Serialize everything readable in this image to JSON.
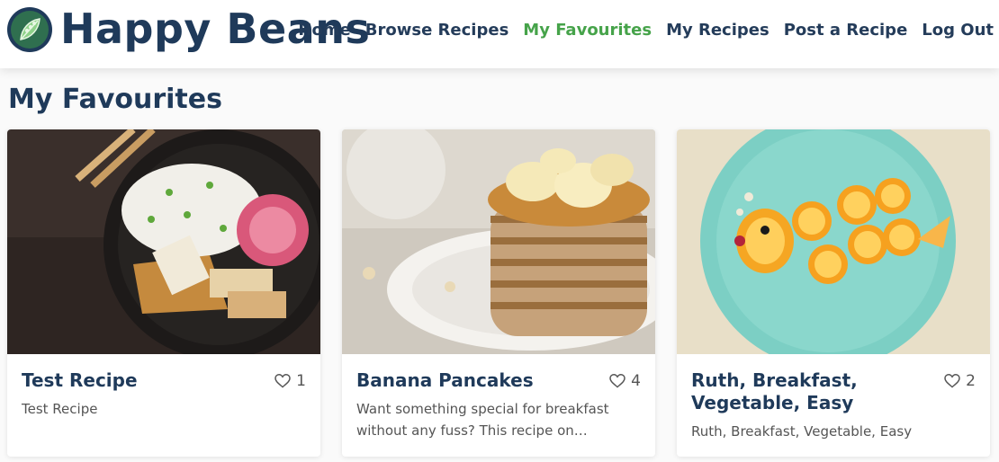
{
  "brand": {
    "name": "Happy Beans",
    "logo_icon": "leaf-icon"
  },
  "nav": {
    "items": [
      {
        "label": "Home",
        "active": false
      },
      {
        "label": "Browse Recipes",
        "active": false
      },
      {
        "label": "My Favourites",
        "active": true
      },
      {
        "label": "My Recipes",
        "active": false
      },
      {
        "label": "Post a Recipe",
        "active": false
      },
      {
        "label": "Log Out",
        "active": false
      }
    ],
    "active_color": "#46a34a"
  },
  "page": {
    "title": "My Favourites"
  },
  "cards": [
    {
      "title": "Test Recipe",
      "likes": "1",
      "description": "Test Recipe",
      "image": "rice-tofu-bowl-photo"
    },
    {
      "title": "Banana Pancakes",
      "likes": "4",
      "description": "Want something special for breakfast without any fuss? This recipe on…",
      "image": "banana-pancakes-photo"
    },
    {
      "title": "Ruth, Breakfast, Vegetable, Easy",
      "likes": "2",
      "description": "Ruth, Breakfast, Vegetable, Easy",
      "image": "orange-fish-plate-photo"
    }
  ],
  "colors": {
    "primary": "#1f3a5a",
    "accent": "#46a34a"
  }
}
